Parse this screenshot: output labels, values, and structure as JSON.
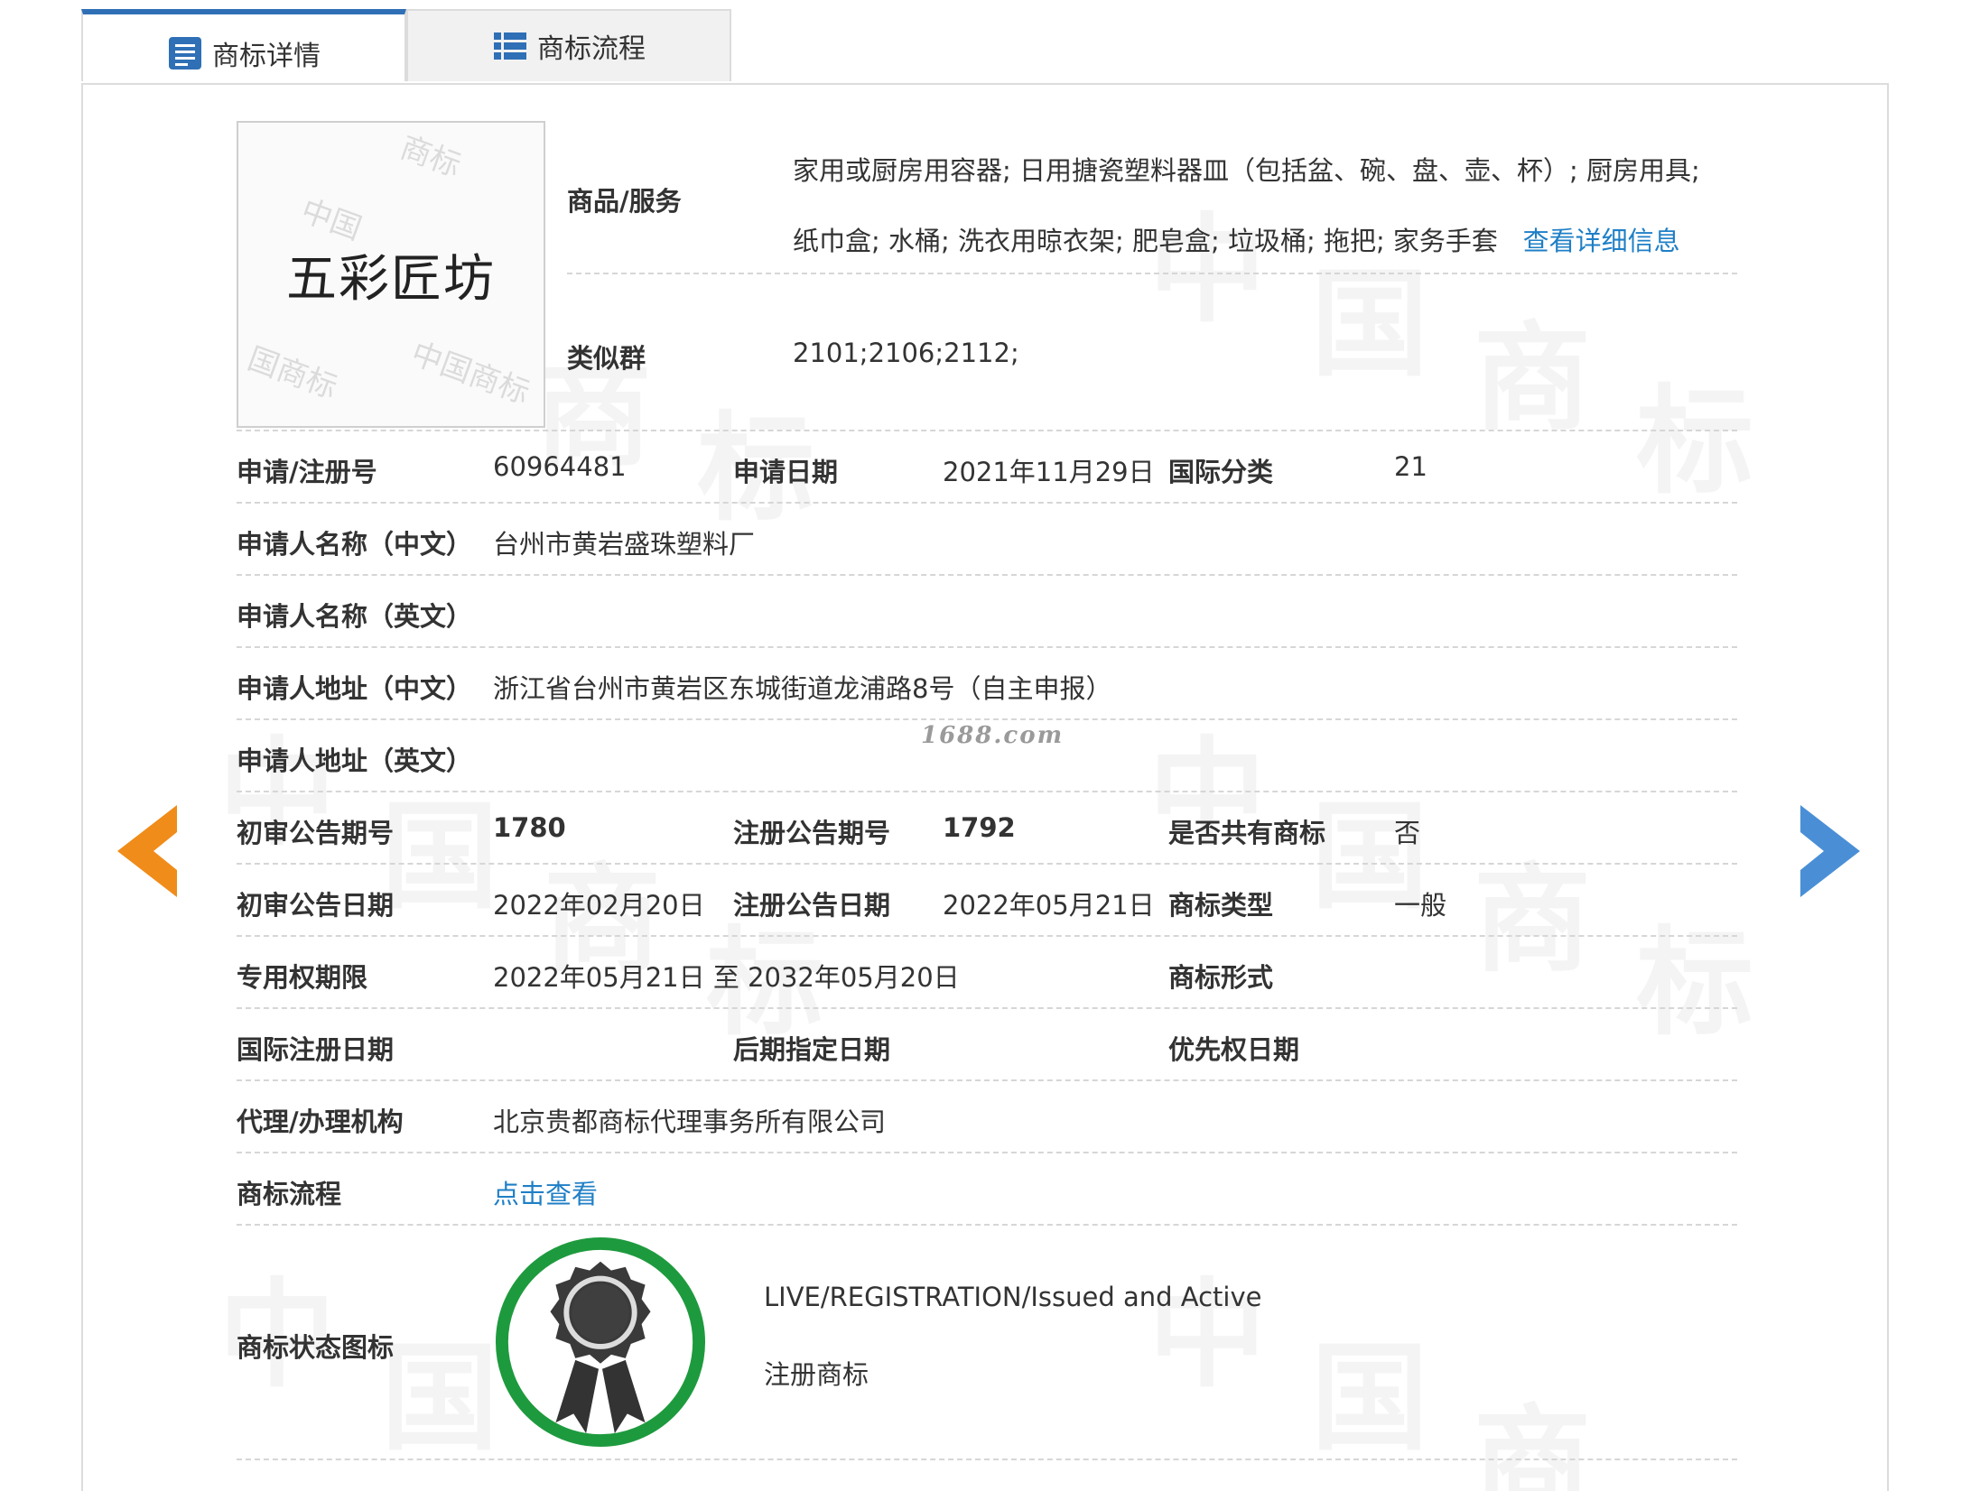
{
  "tabs": [
    {
      "label": "商标详情",
      "icon": "document-list-icon",
      "active": true
    },
    {
      "label": "商标流程",
      "icon": "list-icon",
      "active": false
    }
  ],
  "logo": {
    "text": "五彩匠坊"
  },
  "goods": {
    "label": "商品/服务",
    "value": "家用或厨房用容器; 日用搪瓷塑料器皿（包括盆、碗、盘、壶、杯）; 厨房用具; 纸巾盒; 水桶; 洗衣用晾衣架; 肥皂盒; 垃圾桶; 拖把; 家务手套",
    "more_link": "查看详细信息"
  },
  "similar": {
    "label": "类似群",
    "value": "2101;2106;2112;"
  },
  "fields": {
    "reg_no": {
      "label": "申请/注册号",
      "value": "60964481"
    },
    "apply_date": {
      "label": "申请日期",
      "value": "2021年11月29日"
    },
    "intl_class": {
      "label": "国际分类",
      "value": "21"
    },
    "applicant_cn": {
      "label": "申请人名称（中文）",
      "value": "台州市黄岩盛珠塑料厂"
    },
    "applicant_en": {
      "label": "申请人名称（英文）",
      "value": ""
    },
    "address_cn": {
      "label": "申请人地址（中文）",
      "value": "浙江省台州市黄岩区东城街道龙浦路8号（自主申报）"
    },
    "address_en": {
      "label": "申请人地址（英文）",
      "value": ""
    },
    "prelim_issue": {
      "label": "初审公告期号",
      "value": "1780"
    },
    "reg_issue": {
      "label": "注册公告期号",
      "value": "1792"
    },
    "shared": {
      "label": "是否共有商标",
      "value": "否"
    },
    "prelim_date": {
      "label": "初审公告日期",
      "value": "2022年02月20日"
    },
    "reg_date": {
      "label": "注册公告日期",
      "value": "2022年05月21日"
    },
    "tm_type": {
      "label": "商标类型",
      "value": "一般"
    },
    "exclusive_period": {
      "label": "专用权期限",
      "value": "2022年05月21日 至 2032年05月20日"
    },
    "tm_form": {
      "label": "商标形式",
      "value": ""
    },
    "intl_reg_date": {
      "label": "国际注册日期",
      "value": ""
    },
    "later_date": {
      "label": "后期指定日期",
      "value": ""
    },
    "priority_date": {
      "label": "优先权日期",
      "value": ""
    },
    "agent": {
      "label": "代理/办理机构",
      "value": "北京贵都商标代理事务所有限公司"
    },
    "process": {
      "label": "商标流程",
      "value": "点击查看"
    },
    "status_icon": {
      "label": "商标状态图标"
    }
  },
  "status": {
    "en": "LIVE/REGISTRATION/Issued and Active",
    "cn": "注册商标"
  },
  "watermark_site": "1688.com",
  "colors": {
    "tab_accent": "#2f6fb6",
    "link": "#1f7fc6",
    "prev_arrow": "#f08c1a",
    "next_arrow": "#4a8fd6",
    "badge_ring": "#1e9a3e"
  }
}
